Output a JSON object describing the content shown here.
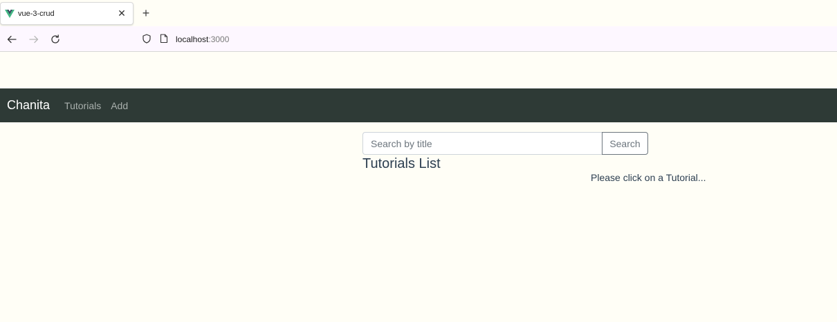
{
  "browser": {
    "tab": {
      "title": "vue-3-crud",
      "favicon": "vue-logo-icon",
      "close_glyph": "✕"
    },
    "new_tab_glyph": "+",
    "url": {
      "host": "localhost",
      "port": ":3000"
    }
  },
  "app": {
    "brand": "Chanita",
    "nav": [
      {
        "label": "Tutorials"
      },
      {
        "label": "Add"
      }
    ],
    "search": {
      "placeholder": "Search by title",
      "value": "",
      "button_label": "Search"
    },
    "list_title": "Tutorials List",
    "hint": "Please click on a Tutorial..."
  },
  "colors": {
    "page_background": "#fffef6",
    "navbar": "#2e3a36",
    "heading_text": "#2c3e50",
    "vue_green": "#41b883",
    "vue_dark": "#35495e"
  }
}
